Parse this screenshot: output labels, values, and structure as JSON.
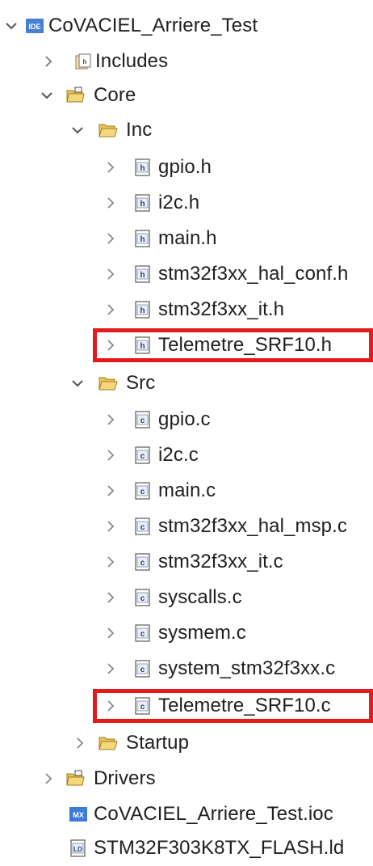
{
  "tree": {
    "rows": [
      {
        "label": "CoVACIEL_Arriere_Test",
        "icon": "project-ide-icon",
        "expanded": true,
        "has_children": true
      },
      {
        "label": "Includes",
        "icon": "includes-icon",
        "expanded": false,
        "has_children": true
      },
      {
        "label": "Core",
        "icon": "source-folder-icon",
        "expanded": true,
        "has_children": true
      },
      {
        "label": "Inc",
        "icon": "folder-open-icon",
        "expanded": true,
        "has_children": true
      },
      {
        "label": "gpio.h",
        "icon": "header-file-icon",
        "expanded": false,
        "has_children": true
      },
      {
        "label": "i2c.h",
        "icon": "header-file-icon",
        "expanded": false,
        "has_children": true
      },
      {
        "label": "main.h",
        "icon": "header-file-icon",
        "expanded": false,
        "has_children": true
      },
      {
        "label": "stm32f3xx_hal_conf.h",
        "icon": "header-file-icon",
        "expanded": false,
        "has_children": true
      },
      {
        "label": "stm32f3xx_it.h",
        "icon": "header-file-icon",
        "expanded": false,
        "has_children": true
      },
      {
        "label": "Telemetre_SRF10.h",
        "icon": "header-file-icon",
        "expanded": false,
        "has_children": true,
        "highlighted": true
      },
      {
        "label": "Src",
        "icon": "folder-open-icon",
        "expanded": true,
        "has_children": true
      },
      {
        "label": "gpio.c",
        "icon": "c-file-icon",
        "expanded": false,
        "has_children": true
      },
      {
        "label": "i2c.c",
        "icon": "c-file-icon",
        "expanded": false,
        "has_children": true
      },
      {
        "label": "main.c",
        "icon": "c-file-icon",
        "expanded": false,
        "has_children": true
      },
      {
        "label": "stm32f3xx_hal_msp.c",
        "icon": "c-file-icon",
        "expanded": false,
        "has_children": true
      },
      {
        "label": "stm32f3xx_it.c",
        "icon": "c-file-icon",
        "expanded": false,
        "has_children": true
      },
      {
        "label": "syscalls.c",
        "icon": "c-file-icon",
        "expanded": false,
        "has_children": true
      },
      {
        "label": "sysmem.c",
        "icon": "c-file-icon",
        "expanded": false,
        "has_children": true
      },
      {
        "label": "system_stm32f3xx.c",
        "icon": "c-file-icon",
        "expanded": false,
        "has_children": true
      },
      {
        "label": "Telemetre_SRF10.c",
        "icon": "c-file-icon",
        "expanded": false,
        "has_children": true,
        "highlighted": true
      },
      {
        "label": "Startup",
        "icon": "folder-open-icon",
        "expanded": false,
        "has_children": true
      },
      {
        "label": "Drivers",
        "icon": "source-folder-icon",
        "expanded": false,
        "has_children": true
      },
      {
        "label": "CoVACIEL_Arriere_Test.ioc",
        "icon": "mx-ioc-file-icon",
        "expanded": false,
        "has_children": false
      },
      {
        "label": "STM32F303K8TX_FLASH.ld",
        "icon": "linker-script-icon",
        "expanded": false,
        "has_children": false
      }
    ]
  },
  "colors": {
    "highlight": "#e31b1b",
    "folder": "#e9c25a",
    "ide_badge": "#4a7fd6",
    "mx_badge": "#3d7bd8"
  }
}
